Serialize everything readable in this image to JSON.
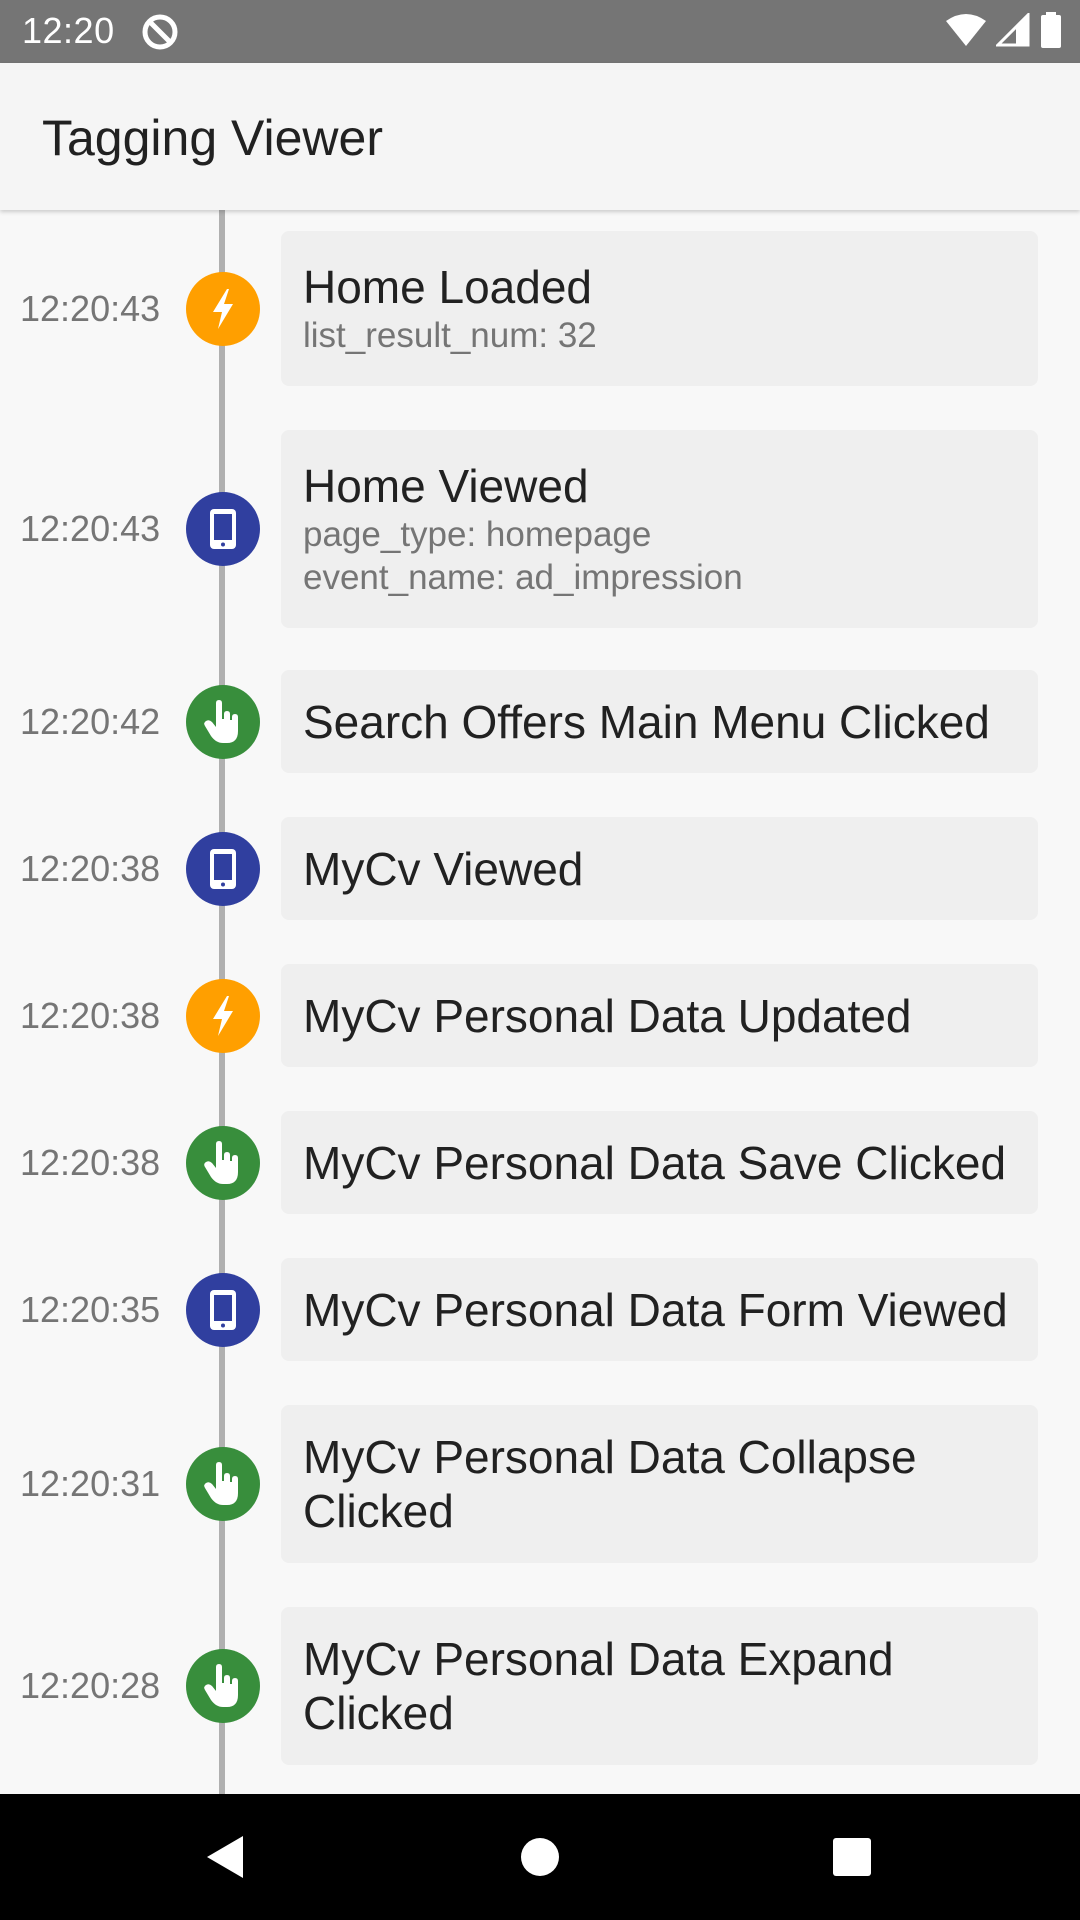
{
  "status_bar": {
    "time": "12:20",
    "icons": [
      "at-sign-icon",
      "wifi-icon",
      "signal-icon",
      "battery-icon"
    ]
  },
  "app_bar": {
    "title": "Tagging Viewer"
  },
  "colors": {
    "action": "#ff9f00",
    "screen": "#303f9f",
    "click": "#388e3c"
  },
  "events": [
    {
      "time": "12:20:43",
      "type": "action",
      "icon": "lightning-icon",
      "title": "Home Loaded",
      "props": [
        "list_result_num: 32"
      ]
    },
    {
      "time": "12:20:43",
      "type": "screen",
      "icon": "smartphone-icon",
      "title": "Home Viewed",
      "props": [
        "page_type: homepage",
        "event_name: ad_impression"
      ]
    },
    {
      "time": "12:20:42",
      "type": "click",
      "icon": "touch-icon",
      "title": "Search Offers Main Menu Clicked",
      "props": []
    },
    {
      "time": "12:20:38",
      "type": "screen",
      "icon": "smartphone-icon",
      "title": "MyCv Viewed",
      "props": []
    },
    {
      "time": "12:20:38",
      "type": "action",
      "icon": "lightning-icon",
      "title": "MyCv Personal Data Updated",
      "props": []
    },
    {
      "time": "12:20:38",
      "type": "click",
      "icon": "touch-icon",
      "title": "MyCv Personal Data Save Clicked",
      "props": []
    },
    {
      "time": "12:20:35",
      "type": "screen",
      "icon": "smartphone-icon",
      "title": "MyCv Personal Data Form Viewed",
      "props": []
    },
    {
      "time": "12:20:31",
      "type": "click",
      "icon": "touch-icon",
      "title": "MyCv Personal Data Collapse Clicked",
      "props": []
    },
    {
      "time": "12:20:28",
      "type": "click",
      "icon": "touch-icon",
      "title": "MyCv Personal Data Expand Clicked",
      "props": []
    }
  ],
  "nav_bar": {
    "buttons": [
      "back-icon",
      "home-icon",
      "recents-icon"
    ]
  }
}
